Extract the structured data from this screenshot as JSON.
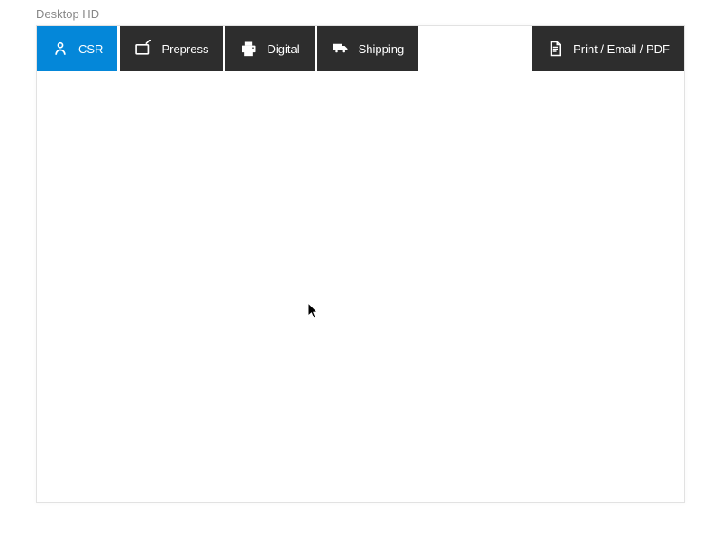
{
  "window": {
    "title": "Desktop HD"
  },
  "tabs": {
    "csr": {
      "label": "CSR"
    },
    "prepress": {
      "label": "Prepress"
    },
    "digital": {
      "label": "Digital"
    },
    "shipping": {
      "label": "Shipping"
    },
    "print_email_pdf": {
      "label": "Print / Email / PDF"
    }
  },
  "colors": {
    "tab_bg": "#2d2d2d",
    "tab_active_bg": "#0487d9",
    "text": "#ffffff"
  }
}
